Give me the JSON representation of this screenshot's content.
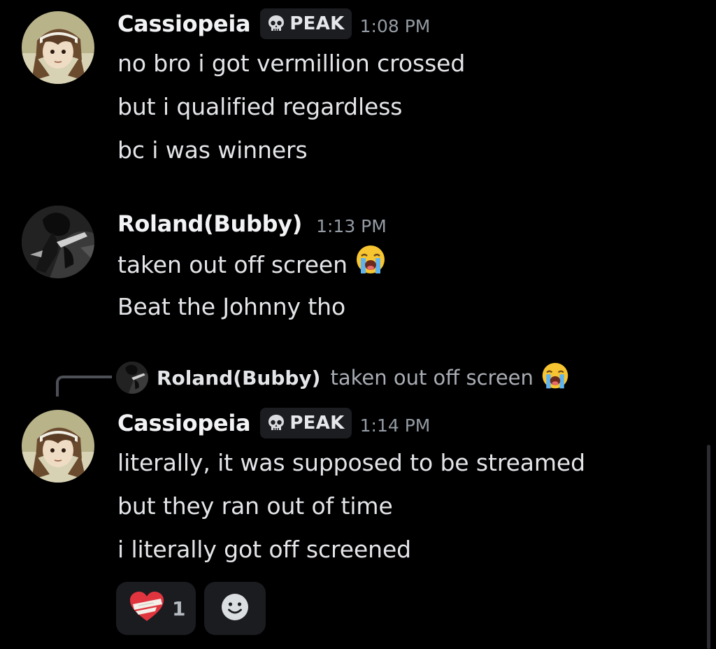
{
  "messages": [
    {
      "author": "Cassiopeia",
      "tag": "PEAK",
      "tag_icon": "skull-icon",
      "time": "1:08 PM",
      "lines": [
        "no bro i got vermillion crossed",
        "but i qualified regardless",
        "bc i was winners"
      ]
    },
    {
      "author": "Roland(Bubby)",
      "time": "1:13 PM",
      "lines": [
        "taken out off screen",
        "Beat the Johnny tho"
      ],
      "line_emoji": "loudly-crying-face-icon"
    },
    {
      "reply_to": {
        "author": "Roland(Bubby)",
        "text": "taken out off screen",
        "emoji": "loudly-crying-face-icon"
      },
      "author": "Cassiopeia",
      "tag": "PEAK",
      "tag_icon": "skull-icon",
      "time": "1:14 PM",
      "lines": [
        "literally, it was supposed to be streamed",
        "but they ran out of time",
        "i literally got off screened"
      ],
      "reactions": [
        {
          "icon": "mending-heart-icon",
          "count": "1"
        },
        {
          "icon": "add-reaction-smiley-icon"
        }
      ]
    }
  ],
  "colors": {
    "background": "#000000",
    "username": "#f2f3f5",
    "timestamp": "#949ba4",
    "text": "#e3e5e8",
    "reaction_bg": "#1b1c20"
  }
}
